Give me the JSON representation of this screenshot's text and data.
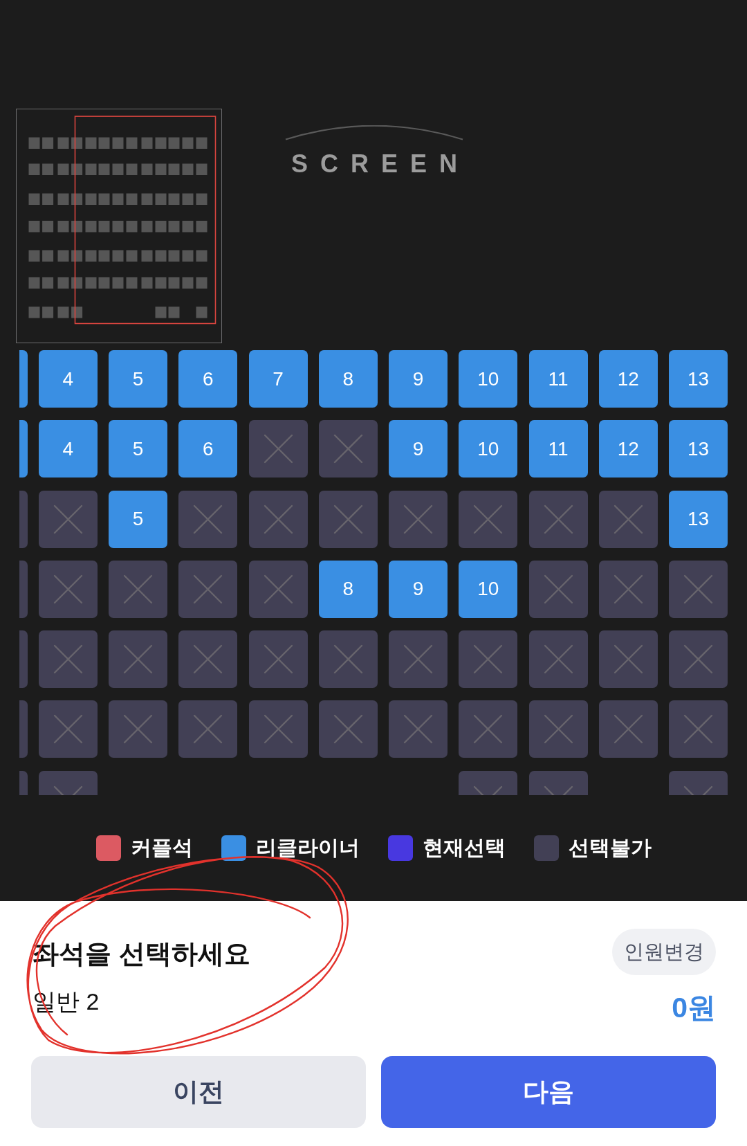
{
  "screen": {
    "label": "SCREEN"
  },
  "seat_rows": [
    {
      "seats": [
        {
          "kind": "available",
          "selected": false
        },
        {
          "kind": "available",
          "selected": false,
          "number": "4"
        },
        {
          "kind": "available",
          "selected": false,
          "number": "5"
        },
        {
          "kind": "available",
          "selected": false,
          "number": "6"
        },
        {
          "kind": "available",
          "selected": false,
          "number": "7"
        },
        {
          "kind": "available",
          "selected": false,
          "number": "8"
        },
        {
          "kind": "available",
          "selected": false,
          "number": "9"
        },
        {
          "kind": "available",
          "selected": false,
          "number": "10"
        },
        {
          "kind": "available",
          "selected": false,
          "number": "11"
        },
        {
          "kind": "available",
          "selected": false,
          "number": "12"
        },
        {
          "kind": "available",
          "selected": false,
          "number": "13"
        }
      ]
    },
    {
      "seats": [
        {
          "kind": "available",
          "selected": false
        },
        {
          "kind": "available",
          "selected": false,
          "number": "4"
        },
        {
          "kind": "available",
          "selected": false,
          "number": "5"
        },
        {
          "kind": "available",
          "selected": false,
          "number": "6"
        },
        {
          "kind": "unavailable",
          "selected": false
        },
        {
          "kind": "unavailable",
          "selected": false
        },
        {
          "kind": "available",
          "selected": false,
          "number": "9"
        },
        {
          "kind": "available",
          "selected": false,
          "number": "10"
        },
        {
          "kind": "available",
          "selected": false,
          "number": "11"
        },
        {
          "kind": "available",
          "selected": false,
          "number": "12"
        },
        {
          "kind": "available",
          "selected": false,
          "number": "13"
        }
      ]
    },
    {
      "seats": [
        {
          "kind": "unavailable",
          "selected": false
        },
        {
          "kind": "unavailable",
          "selected": false
        },
        {
          "kind": "available",
          "selected": false,
          "number": "5"
        },
        {
          "kind": "unavailable",
          "selected": false
        },
        {
          "kind": "unavailable",
          "selected": false
        },
        {
          "kind": "unavailable",
          "selected": false
        },
        {
          "kind": "unavailable",
          "selected": false
        },
        {
          "kind": "unavailable",
          "selected": false
        },
        {
          "kind": "unavailable",
          "selected": false
        },
        {
          "kind": "unavailable",
          "selected": false
        },
        {
          "kind": "available",
          "selected": false,
          "number": "13"
        }
      ]
    },
    {
      "seats": [
        {
          "kind": "unavailable",
          "selected": false
        },
        {
          "kind": "unavailable",
          "selected": false
        },
        {
          "kind": "unavailable",
          "selected": false
        },
        {
          "kind": "unavailable",
          "selected": false
        },
        {
          "kind": "unavailable",
          "selected": false
        },
        {
          "kind": "available",
          "selected": false,
          "number": "8"
        },
        {
          "kind": "available",
          "selected": false,
          "number": "9"
        },
        {
          "kind": "available",
          "selected": false,
          "number": "10"
        },
        {
          "kind": "unavailable",
          "selected": false
        },
        {
          "kind": "unavailable",
          "selected": false
        },
        {
          "kind": "unavailable",
          "selected": false
        }
      ]
    },
    {
      "seats": [
        {
          "kind": "unavailable",
          "selected": false
        },
        {
          "kind": "unavailable",
          "selected": false
        },
        {
          "kind": "unavailable",
          "selected": false
        },
        {
          "kind": "unavailable",
          "selected": false
        },
        {
          "kind": "unavailable",
          "selected": false
        },
        {
          "kind": "unavailable",
          "selected": false
        },
        {
          "kind": "unavailable",
          "selected": false
        },
        {
          "kind": "unavailable",
          "selected": false
        },
        {
          "kind": "unavailable",
          "selected": false
        },
        {
          "kind": "unavailable",
          "selected": false
        },
        {
          "kind": "unavailable",
          "selected": false
        }
      ]
    },
    {
      "seats": [
        {
          "kind": "unavailable",
          "selected": false
        },
        {
          "kind": "unavailable",
          "selected": false
        },
        {
          "kind": "unavailable",
          "selected": false
        },
        {
          "kind": "unavailable",
          "selected": false
        },
        {
          "kind": "unavailable",
          "selected": false
        },
        {
          "kind": "unavailable",
          "selected": false
        },
        {
          "kind": "unavailable",
          "selected": false
        },
        {
          "kind": "unavailable",
          "selected": false
        },
        {
          "kind": "unavailable",
          "selected": false
        },
        {
          "kind": "unavailable",
          "selected": false
        },
        {
          "kind": "unavailable",
          "selected": false
        }
      ]
    },
    {
      "seats": [
        {
          "kind": "unavailable",
          "selected": false
        },
        {
          "kind": "unavailable",
          "selected": false
        },
        {
          "kind": "empty"
        },
        {
          "kind": "empty"
        },
        {
          "kind": "empty"
        },
        {
          "kind": "empty"
        },
        {
          "kind": "empty"
        },
        {
          "kind": "unavailable",
          "selected": false
        },
        {
          "kind": "unavailable",
          "selected": false
        },
        {
          "kind": "empty"
        },
        {
          "kind": "unavailable",
          "selected": false
        }
      ]
    }
  ],
  "legend": [
    {
      "label": "커플석",
      "color": "#dc5a62"
    },
    {
      "label": "리클라이너",
      "color": "#3a8fe3"
    },
    {
      "label": "현재선택",
      "color": "#4838e0"
    },
    {
      "label": "선택불가",
      "color": "#424055"
    }
  ],
  "summary": {
    "title": "좌석을 선택하세요",
    "ticket_count": "일반 2",
    "change_button": "인원변경",
    "price": "0원"
  },
  "buttons": [
    {
      "label": "이전",
      "kind": "secondary"
    },
    {
      "label": "다음",
      "kind": "primary"
    }
  ],
  "markup": {
    "kind": "circle"
  }
}
